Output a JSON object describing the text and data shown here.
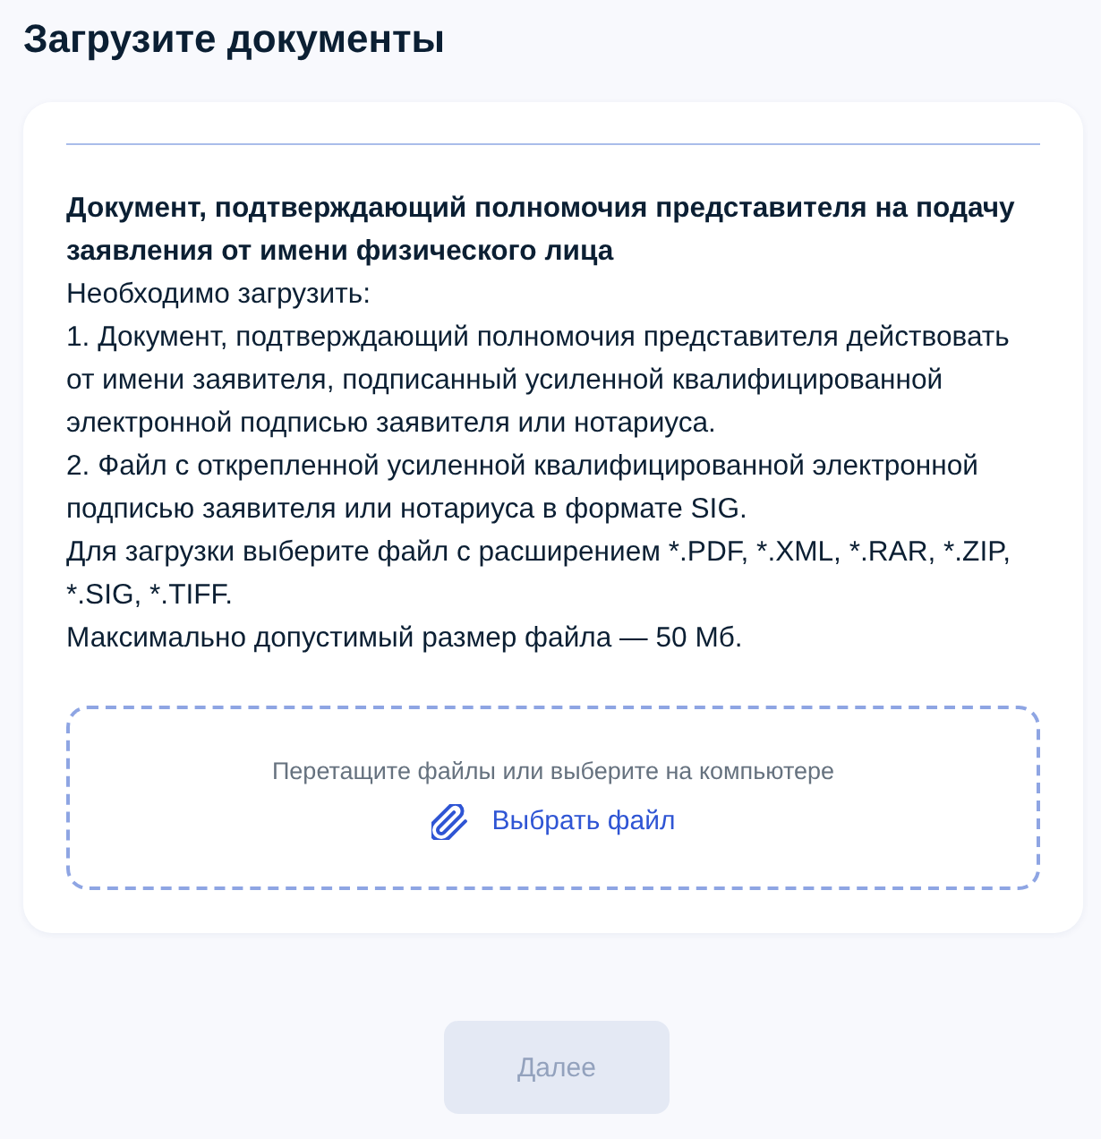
{
  "page": {
    "title": "Загрузите документы"
  },
  "document": {
    "title": "Документ, подтверждающий полномочия представителя на подачу заявления от имени физического лица",
    "paragraphs": [
      "Необходимо загрузить:",
      "1. Документ, подтверждающий полномочия представителя действовать от имени заявителя, подписанный усиленной квалифицированной электронной подписью заявителя или нотариуса.",
      "2. Файл с открепленной усиленной квалифицированной электронной подписью заявителя или нотариуса в формате SIG.",
      "Для загрузки выберите файл с расширением *.PDF, *.XML, *.RAR, *.ZIP, *.SIG, *.TIFF.",
      "Максимально допустимый размер файла — 50 Мб."
    ]
  },
  "upload": {
    "hint": "Перетащите файлы или выберите на компьютере",
    "link": "Выбрать файл"
  },
  "next_button": {
    "label": "Далее",
    "disabled": true
  }
}
